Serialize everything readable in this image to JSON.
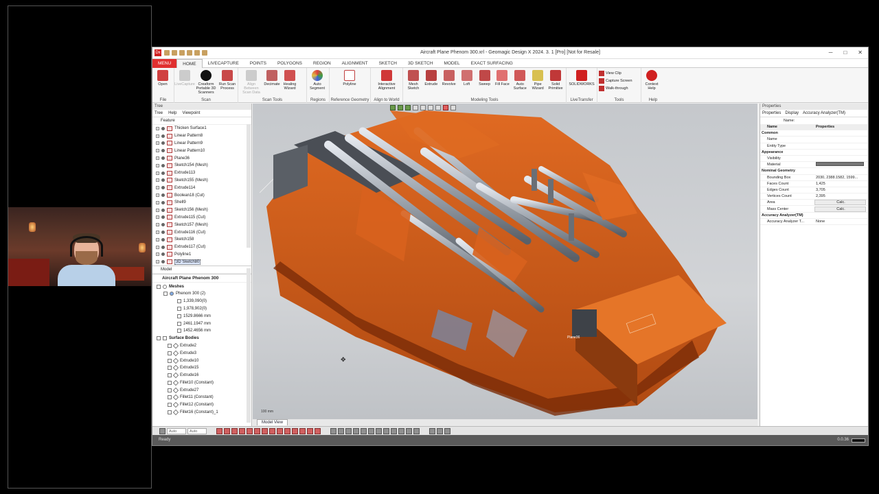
{
  "window": {
    "title": "Aircraft Plane Phenom 300.xrl - Geomagic Design X 2024. 3. 1 [Pro] [Not for Resale]",
    "logo": "Dx",
    "min": "─",
    "max": "□",
    "close": "✕"
  },
  "tabs": [
    "MENU",
    "HOME",
    "LIVECAPTURE",
    "POINTS",
    "POLYGONS",
    "REGION",
    "ALIGNMENT",
    "SKETCH",
    "3D SKETCH",
    "MODEL",
    "EXACT SURFACING"
  ],
  "ribbon": {
    "file": {
      "label": "File",
      "buttons": [
        "Open"
      ]
    },
    "scan": {
      "label": "Scan",
      "buttons": [
        "LiveCapture",
        "Creaform Portable 3D Scanners",
        "Run Scan Process"
      ]
    },
    "scan_tools": {
      "label": "Scan Tools",
      "buttons": [
        "Align Between Scan Data",
        "Decimate",
        "Healing Wizard"
      ]
    },
    "regions": {
      "label": "Regions",
      "buttons": [
        "Auto Segment"
      ]
    },
    "reference_geometry": {
      "label": "Reference Geometry",
      "buttons": [
        "Polyline"
      ]
    },
    "align": {
      "label": "Align to World",
      "buttons": [
        "Interactive Alignment"
      ]
    },
    "modeling": {
      "label": "Modeling Tools",
      "buttons": [
        "Mesh Sketch",
        "Extrude",
        "Revolve",
        "Loft",
        "Sweep",
        "Fill Face",
        "Auto Surface",
        "Pipe Wizard",
        "Solid Primitive"
      ]
    },
    "livetransfer": {
      "label": "LiveTransfer",
      "buttons": [
        "SOLIDWORKS"
      ]
    },
    "tools": {
      "label": "Tools",
      "items": [
        "View Clip",
        "Capture Screen",
        "Walk-through"
      ]
    },
    "help": {
      "label": "Help",
      "buttons": [
        "Context Help"
      ]
    }
  },
  "left_panel": {
    "title": "Tree",
    "subtabs": [
      "Tree",
      "Help",
      "Viewpoint"
    ],
    "feature_label": "Feature",
    "features": [
      "Thicken Surface1",
      "Linear Pattern8",
      "Linear Pattern9",
      "Linear Pattern10",
      "Plane36",
      "Sketch154 (Mesh)",
      "Extrude113",
      "Sketch155 (Mesh)",
      "Extrude114",
      "Boolean18 (Cut)",
      "Shell9",
      "Sketch156 (Mesh)",
      "Extrude115 (Cut)",
      "Sketch157 (Mesh)",
      "Extrude116 (Cut)",
      "Sketch158",
      "Extrude117 (Cut)",
      "Polyline1",
      "3D Sketch80"
    ],
    "model_label": "Model",
    "model_title": "Aircraft Plane Phenom 300",
    "meshes_label": "Meshes",
    "mesh_name": "Phenom 300 (2)",
    "mesh_stats": [
      "1,339,090(0)",
      "1,978,902(0)",
      "1529.8666 mm",
      "2461.1947 mm",
      "1452.4656 mm"
    ],
    "surface_bodies_label": "Surface Bodies",
    "surface_bodies": [
      "Extrude2",
      "Extrude3",
      "Extrude10",
      "Extrude15",
      "Extrude16",
      "Fillet10 (Constant)",
      "Extrude27",
      "Fillet11 (Constant)",
      "Fillet12 (Constant)",
      "Fillet16 (Constant)_1"
    ]
  },
  "viewport": {
    "tab_label": "Model View",
    "scale_label": "100 mm",
    "annotation": "Plane36"
  },
  "right_panel": {
    "title": "Properties",
    "subtabs": [
      "Properties",
      "Display",
      "Accuracy Analyzer(TM)"
    ],
    "name_label": "Name:",
    "col_name": "Name",
    "col_props": "Properties",
    "rows": [
      {
        "k": "Common",
        "v": "",
        "cat": true
      },
      {
        "k": "Name",
        "v": ""
      },
      {
        "k": "Entity Type",
        "v": ""
      },
      {
        "k": "Appearance",
        "v": "",
        "cat": true
      },
      {
        "k": "Visibility",
        "v": ""
      },
      {
        "k": "Material",
        "v": ""
      },
      {
        "k": "Nominal Geometry",
        "v": "",
        "cat": true
      },
      {
        "k": "Bounding Box",
        "v": "2030, 2388.1582, 1599..."
      },
      {
        "k": "Faces Count",
        "v": "1,425"
      },
      {
        "k": "Edges Count",
        "v": "3,705"
      },
      {
        "k": "Vertices Count",
        "v": "2,395"
      },
      {
        "k": "Area",
        "v": "Calc.",
        "btn": true
      },
      {
        "k": "Mass Center",
        "v": "Calc.",
        "btn": true
      },
      {
        "k": "Accuracy Analyzer(TM)",
        "v": "",
        "cat": true
      },
      {
        "k": "Accuracy Analyzer T...",
        "v": "None"
      }
    ]
  },
  "bottom_toolbar": {
    "select1": "Auto",
    "select2": "Auto"
  },
  "status": {
    "text": "Ready",
    "coords": "0.0.36"
  },
  "colors": {
    "accent": "#e03030",
    "scan_orange": "#d8621e",
    "cad_gray": "#9aa1aa"
  }
}
